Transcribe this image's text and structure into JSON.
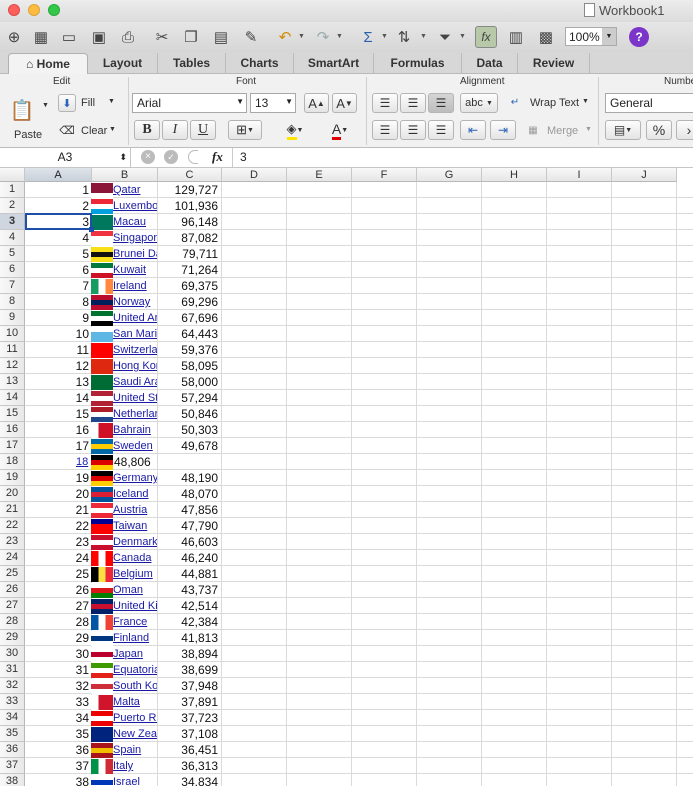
{
  "window": {
    "title": "Workbook1"
  },
  "toolbar": {
    "zoom": "100%"
  },
  "tabs": [
    "Home",
    "Layout",
    "Tables",
    "Charts",
    "SmartArt",
    "Formulas",
    "Data",
    "Review"
  ],
  "ribbon": {
    "groups": {
      "edit": "Edit",
      "font": "Font",
      "alignment": "Alignment",
      "number": "Number"
    },
    "paste": "Paste",
    "fill": "Fill",
    "clear": "Clear",
    "font_name": "Arial",
    "font_size": "13",
    "bold": "B",
    "italic": "I",
    "underline": "U",
    "wrap_text": "Wrap Text",
    "merge": "Merge",
    "number_format": "General",
    "abc": "abc"
  },
  "formula_bar": {
    "cell_ref": "A3",
    "fx": "fx",
    "value": "3"
  },
  "columns": [
    "A",
    "B",
    "C",
    "D",
    "E",
    "F",
    "G",
    "H",
    "I",
    "J"
  ],
  "rows": [
    {
      "n": "1",
      "a": "1",
      "b": "Qatar",
      "c": "129,727",
      "flag": [
        "#8a1538",
        "#8a1538",
        "#fff"
      ]
    },
    {
      "n": "2",
      "a": "2",
      "b": "Luxembourg",
      "c": "101,936",
      "flag": [
        "#ed2939",
        "#fff",
        "#00a1de"
      ]
    },
    {
      "n": "3",
      "a": "3",
      "b": "Macau",
      "c": "96,148",
      "flag": [
        "#00785e",
        "#00785e",
        "#00785e"
      ]
    },
    {
      "n": "4",
      "a": "4",
      "b": "Singapore",
      "c": "87,082",
      "flag": [
        "#ef3340",
        "#fff",
        "#fff"
      ]
    },
    {
      "n": "5",
      "a": "5",
      "b": "Brunei Darussalam",
      "c": "79,711",
      "flag": [
        "#f7e017",
        "#111",
        "#f7e017"
      ]
    },
    {
      "n": "6",
      "a": "6",
      "b": "Kuwait",
      "c": "71,264",
      "flag": [
        "#007a3d",
        "#fff",
        "#ce1126"
      ]
    },
    {
      "n": "7",
      "a": "7",
      "b": "Ireland",
      "c": "69,375",
      "flag": [
        "#169b62",
        "#fff",
        "#ff883e"
      ],
      "vertical": true
    },
    {
      "n": "8",
      "a": "8",
      "b": "Norway",
      "c": "69,296",
      "flag": [
        "#ba0c2f",
        "#00205b",
        "#ba0c2f"
      ]
    },
    {
      "n": "9",
      "a": "9",
      "b": "United Arab Emirates",
      "c": "67,696",
      "flag": [
        "#00732f",
        "#fff",
        "#000"
      ]
    },
    {
      "n": "10",
      "a": "10",
      "b": "San Marino",
      "c": "64,443",
      "flag": [
        "#fff",
        "#5eb6e4",
        "#5eb6e4"
      ]
    },
    {
      "n": "11",
      "a": "11",
      "b": "Switzerland",
      "c": "59,376",
      "flag": [
        "#ff0000",
        "#ff0000",
        "#ff0000"
      ]
    },
    {
      "n": "12",
      "a": "12",
      "b": "Hong Kong",
      "c": "58,095",
      "flag": [
        "#de2910",
        "#de2910",
        "#de2910"
      ]
    },
    {
      "n": "13",
      "a": "13",
      "b": "Saudi Arabia",
      "c": "58,000",
      "flag": [
        "#006c35",
        "#006c35",
        "#006c35"
      ]
    },
    {
      "n": "14",
      "a": "14",
      "b": "United States",
      "c": "57,294",
      "flag": [
        "#b22234",
        "#fff",
        "#b22234"
      ]
    },
    {
      "n": "15",
      "a": "15",
      "b": "Netherlands",
      "c": "50,846",
      "flag": [
        "#ae1c28",
        "#fff",
        "#21468b"
      ]
    },
    {
      "n": "16",
      "a": "16",
      "b": "Bahrain",
      "c": "50,303",
      "flag": [
        "#fff",
        "#ce1126",
        "#ce1126"
      ],
      "vertical": true
    },
    {
      "n": "17",
      "a": "17",
      "b": "Sweden",
      "c": "49,678",
      "flag": [
        "#006aa7",
        "#fecc00",
        "#006aa7"
      ]
    },
    {
      "n": "18",
      "a": "18",
      "b": "48,806",
      "c": "",
      "flag": [
        "#000",
        "#dd0000",
        "#ffce00"
      ],
      "odd": true
    },
    {
      "n": "19",
      "a": "19",
      "b": "Germany",
      "c": "48,190",
      "flag": [
        "#000",
        "#dd0000",
        "#ffce00"
      ]
    },
    {
      "n": "20",
      "a": "20",
      "b": "Iceland",
      "c": "48,070",
      "flag": [
        "#02529c",
        "#dc1e35",
        "#02529c"
      ]
    },
    {
      "n": "21",
      "a": "21",
      "b": "Austria",
      "c": "47,856",
      "flag": [
        "#ed2939",
        "#fff",
        "#ed2939"
      ]
    },
    {
      "n": "22",
      "a": "22",
      "b": "Taiwan",
      "c": "47,790",
      "flag": [
        "#000095",
        "#fe0000",
        "#fe0000"
      ]
    },
    {
      "n": "23",
      "a": "23",
      "b": "Denmark",
      "c": "46,603",
      "flag": [
        "#c8102e",
        "#fff",
        "#c8102e"
      ]
    },
    {
      "n": "24",
      "a": "24",
      "b": "Canada",
      "c": "46,240",
      "flag": [
        "#ff0000",
        "#fff",
        "#ff0000"
      ],
      "vertical": true
    },
    {
      "n": "25",
      "a": "25",
      "b": "Belgium",
      "c": "44,881",
      "flag": [
        "#000",
        "#fae042",
        "#ed2939"
      ],
      "vertical": true
    },
    {
      "n": "26",
      "a": "26",
      "b": "Oman",
      "c": "43,737",
      "flag": [
        "#fff",
        "#db161b",
        "#008000"
      ]
    },
    {
      "n": "27",
      "a": "27",
      "b": "United Kingdom",
      "c": "42,514",
      "flag": [
        "#012169",
        "#c8102e",
        "#012169"
      ]
    },
    {
      "n": "28",
      "a": "28",
      "b": "France",
      "c": "42,384",
      "flag": [
        "#0055a4",
        "#fff",
        "#ef4135"
      ],
      "vertical": true
    },
    {
      "n": "29",
      "a": "29",
      "b": "Finland",
      "c": "41,813",
      "flag": [
        "#fff",
        "#003580",
        "#fff"
      ]
    },
    {
      "n": "30",
      "a": "30",
      "b": "Japan",
      "c": "38,894",
      "flag": [
        "#fff",
        "#bc002d",
        "#fff"
      ]
    },
    {
      "n": "31",
      "a": "31",
      "b": "Equatorial Guinea",
      "c": "38,699",
      "flag": [
        "#3e9a00",
        "#fff",
        "#e32118"
      ]
    },
    {
      "n": "32",
      "a": "32",
      "b": "South Korea",
      "c": "37,948",
      "flag": [
        "#fff",
        "#cd2e3a",
        "#fff"
      ]
    },
    {
      "n": "33",
      "a": "33",
      "b": "Malta",
      "c": "37,891",
      "flag": [
        "#fff",
        "#cf142b",
        "#cf142b"
      ],
      "vertical": true
    },
    {
      "n": "34",
      "a": "34",
      "b": "Puerto Rico",
      "c": "37,723",
      "flag": [
        "#ed0000",
        "#fff",
        "#ed0000"
      ]
    },
    {
      "n": "35",
      "a": "35",
      "b": "New Zealand",
      "c": "37,108",
      "flag": [
        "#00247d",
        "#00247d",
        "#00247d"
      ]
    },
    {
      "n": "36",
      "a": "36",
      "b": "Spain",
      "c": "36,451",
      "flag": [
        "#aa151b",
        "#f1bf00",
        "#aa151b"
      ]
    },
    {
      "n": "37",
      "a": "37",
      "b": "Italy",
      "c": "36,313",
      "flag": [
        "#009246",
        "#fff",
        "#ce2b37"
      ],
      "vertical": true
    },
    {
      "n": "38",
      "a": "38",
      "b": "Israel",
      "c": "34,834",
      "flag": [
        "#fff",
        "#0038b8",
        "#fff"
      ]
    }
  ]
}
